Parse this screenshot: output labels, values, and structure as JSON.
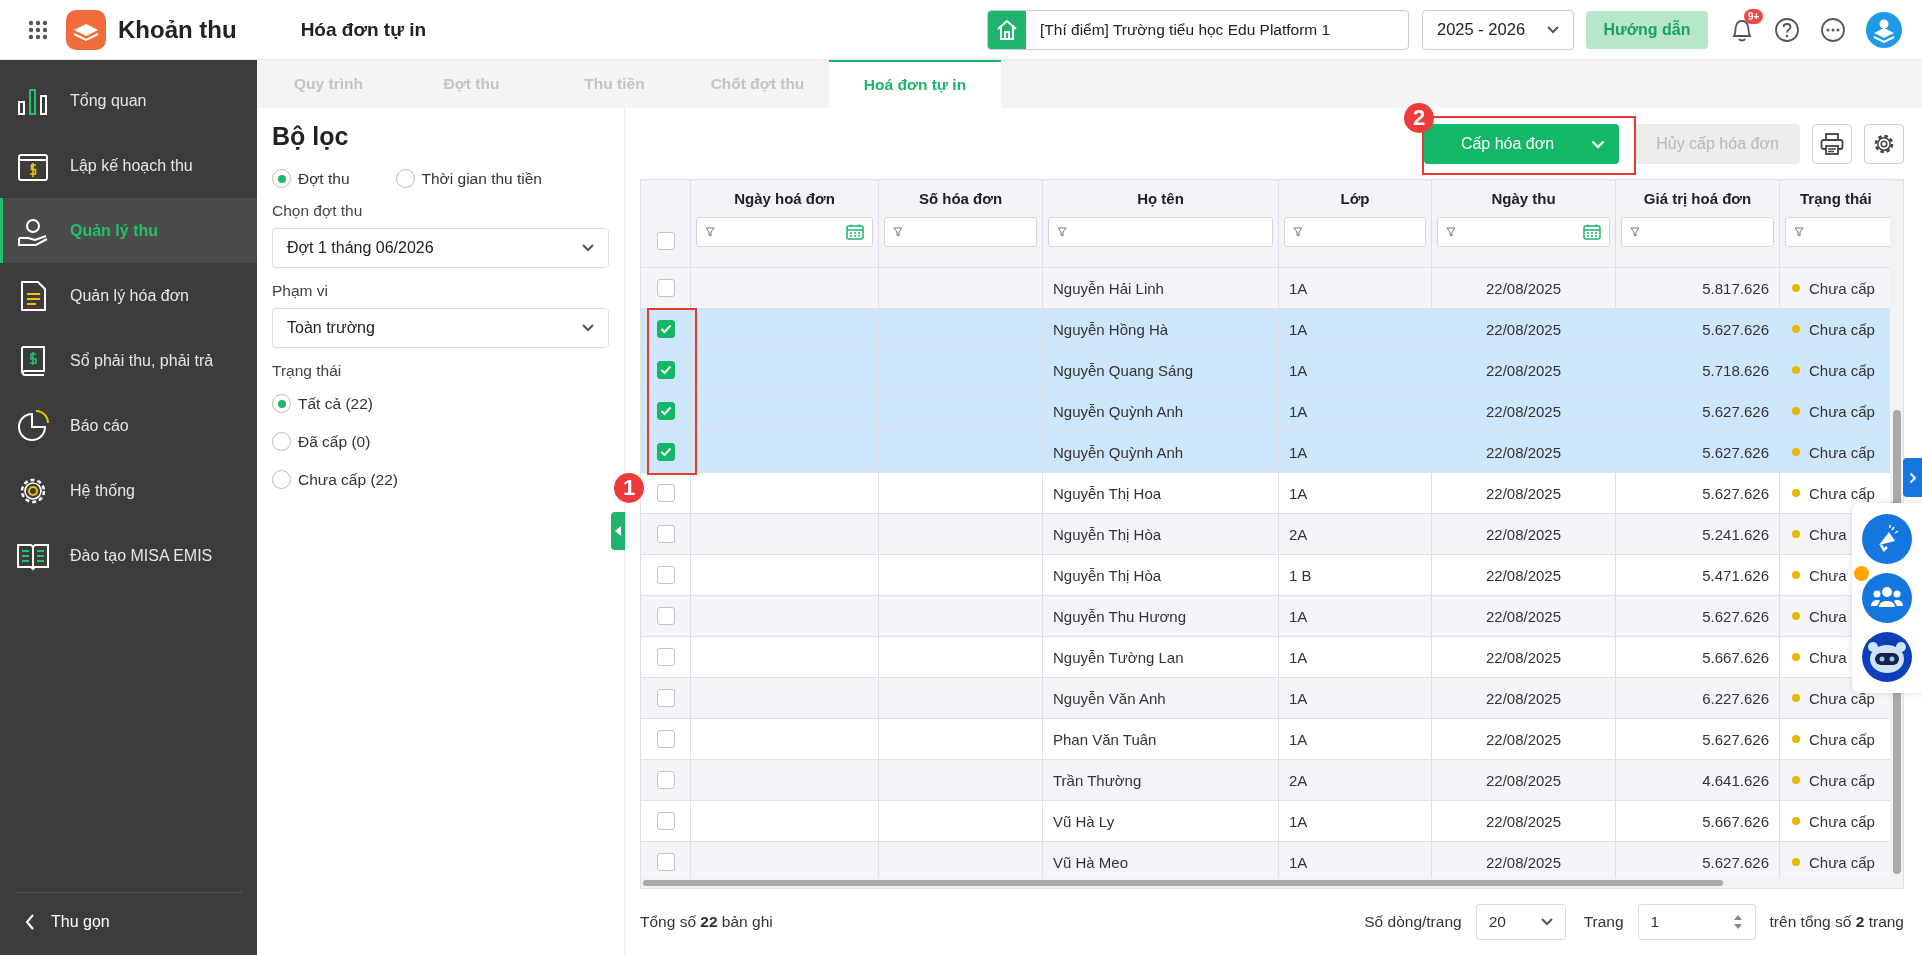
{
  "app": {
    "name": "Khoản thu",
    "page_title": "Hóa đơn tự in"
  },
  "header": {
    "school": "[Thí điểm] Trường tiểu học Edu Platform 1",
    "year": "2025 - 2026",
    "guide_button": "Hướng dẫn",
    "notification_badge": "9+"
  },
  "sidebar": {
    "items": [
      {
        "label": "Tổng quan",
        "selected": false
      },
      {
        "label": "Lập kế hoạch thu",
        "selected": false
      },
      {
        "label": "Quản lý thu",
        "selected": true
      },
      {
        "label": "Quản lý hóa đơn",
        "selected": false
      },
      {
        "label": "Sổ phải thu, phải trả",
        "selected": false
      },
      {
        "label": "Báo cáo",
        "selected": false
      },
      {
        "label": "Hệ thống",
        "selected": false
      },
      {
        "label": "Đào tạo MISA EMIS",
        "selected": false
      }
    ],
    "collapse": "Thu gọn"
  },
  "tabs": [
    {
      "label": "Quy trình",
      "selected": false
    },
    {
      "label": "Đợt thu",
      "selected": false
    },
    {
      "label": "Thu tiền",
      "selected": false
    },
    {
      "label": "Chốt đợt thu",
      "selected": false
    },
    {
      "label": "Hoá đơn tự in",
      "selected": true
    }
  ],
  "filter": {
    "title": "Bộ lọc",
    "mode_options": [
      {
        "label": "Đợt thu",
        "selected": true
      },
      {
        "label": "Thời gian thu tiền",
        "selected": false
      }
    ],
    "period_label": "Chọn đợt thu",
    "period_value": "Đợt 1 tháng 06/2026",
    "scope_label": "Phạm vi",
    "scope_value": "Toàn trường",
    "status_label": "Trạng thái",
    "status_options": [
      {
        "label": "Tất cả (22)",
        "selected": true
      },
      {
        "label": "Đã cấp (0)",
        "selected": false
      },
      {
        "label": "Chưa cấp (22)",
        "selected": false
      }
    ]
  },
  "toolbar": {
    "issue_button": "Cấp hóa đơn",
    "cancel_button": "Hủy cấp hóa đơn",
    "cancel_disabled": true
  },
  "table": {
    "header_checked": false,
    "columns": [
      {
        "label": "Ngày hoá đơn",
        "kind": "date"
      },
      {
        "label": "Số hóa đơn",
        "kind": "text"
      },
      {
        "label": "Họ tên",
        "kind": "text"
      },
      {
        "label": "Lớp",
        "kind": "text"
      },
      {
        "label": "Ngày thu",
        "kind": "date"
      },
      {
        "label": "Giá trị hoá đơn",
        "kind": "text"
      },
      {
        "label": "Trạng thái",
        "kind": "text"
      }
    ],
    "rows": [
      {
        "checked": false,
        "name": "Nguyễn Hải Linh",
        "class": "1A",
        "date": "22/08/2025",
        "amount": "5.817.626",
        "status": "Chưa cấp"
      },
      {
        "checked": true,
        "name": "Nguyễn Hồng Hà",
        "class": "1A",
        "date": "22/08/2025",
        "amount": "5.627.626",
        "status": "Chưa cấp"
      },
      {
        "checked": true,
        "name": "Nguyễn Quang Sáng",
        "class": "1A",
        "date": "22/08/2025",
        "amount": "5.718.626",
        "status": "Chưa cấp"
      },
      {
        "checked": true,
        "name": "Nguyễn Quỳnh Anh",
        "class": "1A",
        "date": "22/08/2025",
        "amount": "5.627.626",
        "status": "Chưa cấp"
      },
      {
        "checked": true,
        "name": "Nguyễn Quỳnh Anh",
        "class": "1A",
        "date": "22/08/2025",
        "amount": "5.627.626",
        "status": "Chưa cấp"
      },
      {
        "checked": false,
        "name": "Nguyễn Thị Hoa",
        "class": "1A",
        "date": "22/08/2025",
        "amount": "5.627.626",
        "status": "Chưa cấp"
      },
      {
        "checked": false,
        "name": "Nguyễn Thị Hòa",
        "class": "2A",
        "date": "22/08/2025",
        "amount": "5.241.626",
        "status": "Chưa"
      },
      {
        "checked": false,
        "name": "Nguyễn Thị Hòa",
        "class": "1 B",
        "date": "22/08/2025",
        "amount": "5.471.626",
        "status": "Chưa"
      },
      {
        "checked": false,
        "name": "Nguyễn Thu Hương",
        "class": "1A",
        "date": "22/08/2025",
        "amount": "5.627.626",
        "status": "Chưa"
      },
      {
        "checked": false,
        "name": "Nguyễn Tường Lan",
        "class": "1A",
        "date": "22/08/2025",
        "amount": "5.667.626",
        "status": "Chưa"
      },
      {
        "checked": false,
        "name": "Nguyễn Văn Anh",
        "class": "1A",
        "date": "22/08/2025",
        "amount": "6.227.626",
        "status": "Chưa cấp"
      },
      {
        "checked": false,
        "name": "Phan Văn Tuân",
        "class": "1A",
        "date": "22/08/2025",
        "amount": "5.627.626",
        "status": "Chưa cấp"
      },
      {
        "checked": false,
        "name": "Trần Thường",
        "class": "2A",
        "date": "22/08/2025",
        "amount": "4.641.626",
        "status": "Chưa cấp"
      },
      {
        "checked": false,
        "name": "Vũ Hà Ly",
        "class": "1A",
        "date": "22/08/2025",
        "amount": "5.667.626",
        "status": "Chưa cấp"
      },
      {
        "checked": false,
        "name": "Vũ Hà Meo",
        "class": "1A",
        "date": "22/08/2025",
        "amount": "5.627.626",
        "status": "Chưa cấp"
      }
    ]
  },
  "footer": {
    "total": "Tổng số **22** bản ghi",
    "rows_per_page_label": "Số dòng/trang",
    "rows_per_page": "20",
    "page_label": "Trang",
    "page": "1",
    "page_total": "trên tổng số **2** trang"
  },
  "annotations": [
    {
      "number": "1"
    },
    {
      "number": "2"
    }
  ]
}
